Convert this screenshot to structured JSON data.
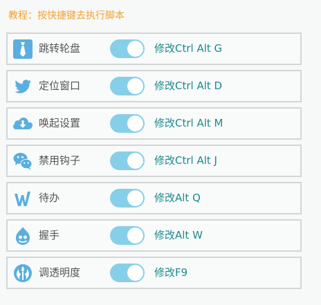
{
  "header": {
    "title": "教程：按快捷键去执行脚本"
  },
  "colors": {
    "accent_orange": "#f2a12e",
    "toggle_on": "#87cfe9",
    "link_teal": "#1b8a8c",
    "icon_blue": "#5aaee0"
  },
  "items": [
    {
      "label": "跳转轮盘",
      "icon": "necktie-icon",
      "enabled": true,
      "shortcut_label": "修改Ctrl Alt G"
    },
    {
      "label": "定位窗口",
      "icon": "twitter-bird-icon",
      "enabled": true,
      "shortcut_label": "修改Ctrl Alt D"
    },
    {
      "label": "唤起设置",
      "icon": "cloud-download-icon",
      "enabled": true,
      "shortcut_label": "修改Ctrl Alt M"
    },
    {
      "label": "禁用钩子",
      "icon": "wechat-icon",
      "enabled": true,
      "shortcut_label": "修改Ctrl Alt J"
    },
    {
      "label": "待办",
      "icon": "wunderlist-icon",
      "enabled": true,
      "shortcut_label": "修改Alt Q"
    },
    {
      "label": "握手",
      "icon": "drupal-drop-icon",
      "enabled": true,
      "shortcut_label": "修改Alt W"
    },
    {
      "label": "调透明度",
      "icon": "rebel-alliance-icon",
      "enabled": true,
      "shortcut_label": "修改F9"
    }
  ]
}
